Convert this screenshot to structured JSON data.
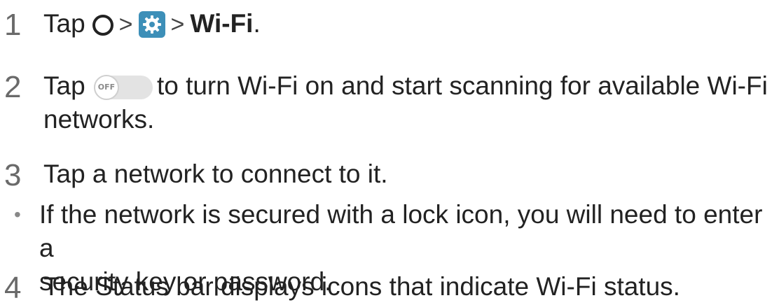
{
  "steps": [
    {
      "number": "1",
      "text_tap": "Tap",
      "separator_1": ">",
      "separator_2": ">",
      "target": "Wi-Fi",
      "period": "."
    },
    {
      "number": "2",
      "text_tap": "Tap",
      "toggle_label": "OFF",
      "text_rest": "to turn Wi-Fi on and start scanning for available Wi-Fi",
      "text_line2": "networks."
    },
    {
      "number": "3",
      "text": "Tap a network to connect to it."
    },
    {
      "number": "4",
      "text": "The Status bar displays icons that indicate Wi-Fi status."
    }
  ],
  "note": {
    "bullet": "•",
    "line1": "If the network is secured with a lock icon, you will need to enter a",
    "line2": "security key or password."
  },
  "icons": {
    "home": "home-button-icon",
    "settings": "settings-gear-icon",
    "toggle": "off-toggle-icon"
  },
  "colors": {
    "settings_bg": "#3d8fb8",
    "step_number": "#6a6a6a"
  }
}
